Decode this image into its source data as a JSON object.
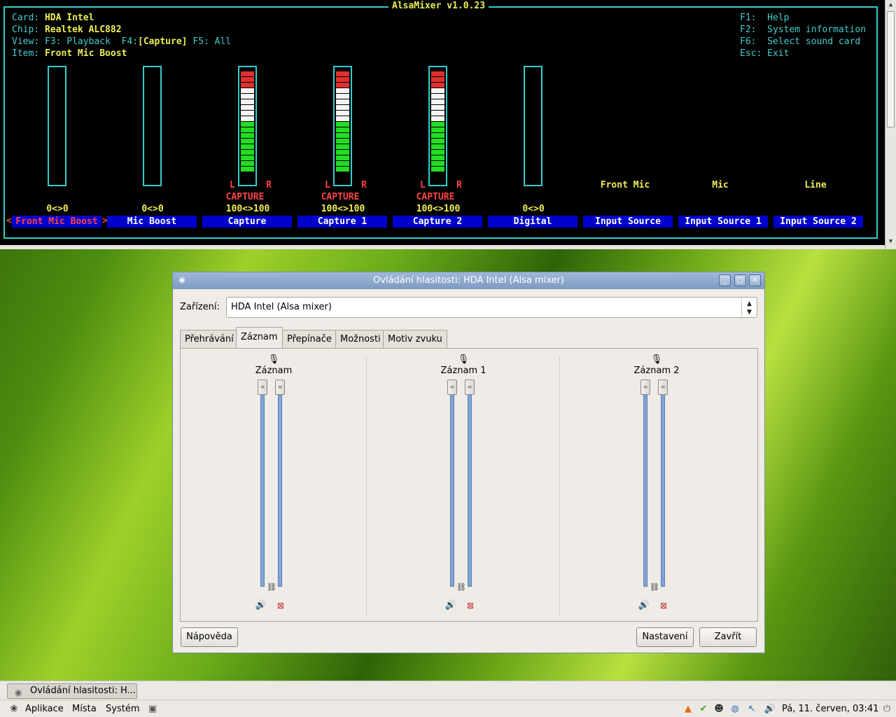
{
  "terminal": {
    "title": "AlsaMixer v1.0.23",
    "info": [
      {
        "key": "Card:",
        "value": "HDA Intel"
      },
      {
        "key": "Chip:",
        "value": "Realtek ALC882"
      }
    ],
    "view": {
      "key": "View:",
      "f3": "F3: Playback",
      "f4_key": "F4:",
      "f4": "[Capture]",
      "f5": "F5: All"
    },
    "item": {
      "key": "Item:",
      "value": "Front Mic Boost"
    },
    "help": [
      {
        "key": "F1:",
        "label": "Help"
      },
      {
        "key": "F2:",
        "label": "System information"
      },
      {
        "key": "F6:",
        "label": "Select sound card"
      },
      {
        "key": "Esc:",
        "label": "Exit"
      }
    ],
    "channels": [
      {
        "name": "Front Mic Boost",
        "value": "0<>0",
        "level": 0,
        "selected": true,
        "sel_left": "<",
        "sel_right": ">"
      },
      {
        "name": "Mic Boost",
        "value": "0<>0",
        "level": 0
      },
      {
        "name": "Capture",
        "value": "100<>100",
        "level": 100,
        "capture": "CAPTURE",
        "left": "L",
        "right": "R"
      },
      {
        "name": "Capture 1",
        "value": "100<>100",
        "level": 100,
        "capture": "CAPTURE",
        "left": "L",
        "right": "R"
      },
      {
        "name": "Capture 2",
        "value": "100<>100",
        "level": 100,
        "capture": "CAPTURE",
        "left": "L",
        "right": "R"
      },
      {
        "name": "Digital",
        "value": "0<>0",
        "level": 0
      },
      {
        "name": "Input Source",
        "source": "Front Mic"
      },
      {
        "name": "Input Source 1",
        "source": "Mic"
      },
      {
        "name": "Input Source 2",
        "source": "Line"
      }
    ]
  },
  "dialog": {
    "title": "Ovládání hlasitosti: HDA Intel (Alsa mixer)",
    "device_label": "Zařízení:",
    "device_value": "HDA Intel (Alsa mixer)",
    "tabs": [
      "Přehrávání",
      "Záznam",
      "Přepínače",
      "Možnosti",
      "Motiv zvuku"
    ],
    "active_tab": 1,
    "channels": [
      {
        "name": "Záznam",
        "level": 100
      },
      {
        "name": "Záznam 1",
        "level": 100
      },
      {
        "name": "Záznam 2",
        "level": 100
      }
    ],
    "help_button": "Nápověda",
    "settings_button": "Nastavení",
    "close_button": "Zavřít"
  },
  "taskbar": {
    "window_button": "Ovládání hlasitosti: H..."
  },
  "panel": {
    "menus": [
      "Aplikace",
      "Místa",
      "Systém"
    ],
    "clock": "Pá, 11. červen, 03:41"
  },
  "colors": {
    "term_cyan": "#33cccc",
    "term_yellow": "#eeee55",
    "term_red": "#ff4444",
    "term_blue": "#0000cc",
    "meter_green": "#22dd22",
    "slider_blue": "#7fa4d6"
  }
}
